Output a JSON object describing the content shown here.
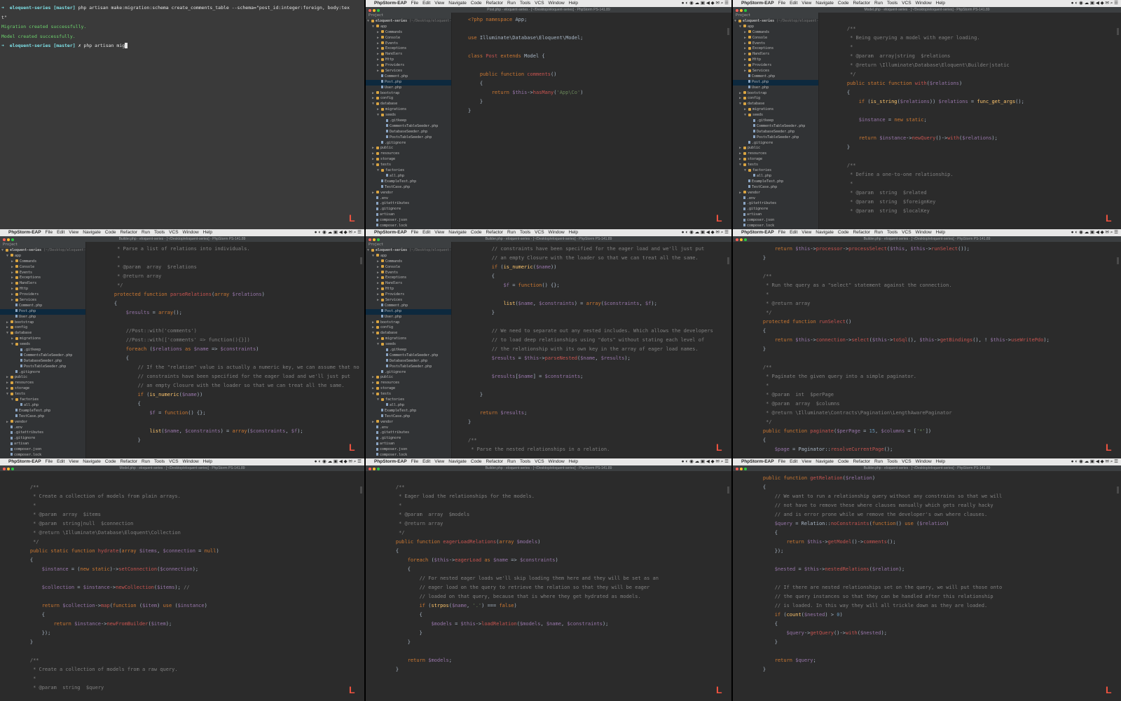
{
  "menubar": {
    "app": "PhpStorm-EAP",
    "items": [
      "File",
      "Edit",
      "View",
      "Navigate",
      "Code",
      "Refactor",
      "Run",
      "Tools",
      "VCS",
      "Window",
      "Help"
    ]
  },
  "terminal": {
    "lines": [
      {
        "prompt": "➜  eloquent-series [master]",
        "cmd": " php artisan make:migration:schema create_comments_table --schema=\"post_id:integer:foreign, body:tex"
      },
      {
        "prompt": "",
        "cmd": "t\""
      },
      {
        "prompt": "",
        "cmd": "Migration created successfully.",
        "cls": "green"
      },
      {
        "prompt": "",
        "cmd": "Model created successfully.",
        "cls": "green"
      },
      {
        "prompt": "➜  eloquent-series [master]",
        "cmd": " ✗ php artisan mig"
      }
    ]
  },
  "titles": {
    "post": "Post.php - eloquent-series - [~/Desktop/eloquent-series] - PhpStorm PS-141.89",
    "model": "Model.php - eloquent-series - [~/Desktop/eloquent-series] - PhpStorm PS-141.89",
    "builder": "Builder.php - eloquent-series - [~/Desktop/eloquent-series] - PhpStorm PS-141.89",
    "builder2": "Builder.php - eloquent-series - [~/Desktop/eloquent-series] - PhpStorm PS-141.89"
  },
  "tree": {
    "project_label": "Project",
    "root": "eloquent-series",
    "root_path": "~/Desktop/eloquent-series",
    "rows": [
      {
        "d": 1,
        "t": "app",
        "folder": true,
        "open": true
      },
      {
        "d": 2,
        "t": "Commands",
        "folder": true
      },
      {
        "d": 2,
        "t": "Console",
        "folder": true
      },
      {
        "d": 2,
        "t": "Events",
        "folder": true
      },
      {
        "d": 2,
        "t": "Exceptions",
        "folder": true
      },
      {
        "d": 2,
        "t": "Handlers",
        "folder": true
      },
      {
        "d": 2,
        "t": "Http",
        "folder": true
      },
      {
        "d": 2,
        "t": "Providers",
        "folder": true
      },
      {
        "d": 2,
        "t": "Services",
        "folder": true
      },
      {
        "d": 2,
        "t": "Comment.php"
      },
      {
        "d": 2,
        "t": "Post.php",
        "sel": true
      },
      {
        "d": 2,
        "t": "User.php"
      },
      {
        "d": 1,
        "t": "bootstrap",
        "folder": true
      },
      {
        "d": 1,
        "t": "config",
        "folder": true
      },
      {
        "d": 1,
        "t": "database",
        "folder": true,
        "open": true
      },
      {
        "d": 2,
        "t": "migrations",
        "folder": true
      },
      {
        "d": 2,
        "t": "seeds",
        "folder": true,
        "open": true
      },
      {
        "d": 3,
        "t": ".gitkeep"
      },
      {
        "d": 3,
        "t": "CommentsTableSeeder.php"
      },
      {
        "d": 3,
        "t": "DatabaseSeeder.php"
      },
      {
        "d": 3,
        "t": "PostsTableSeeder.php"
      },
      {
        "d": 2,
        "t": ".gitignore"
      },
      {
        "d": 1,
        "t": "public",
        "folder": true
      },
      {
        "d": 1,
        "t": "resources",
        "folder": true
      },
      {
        "d": 1,
        "t": "storage",
        "folder": true
      },
      {
        "d": 1,
        "t": "tests",
        "folder": true,
        "open": true
      },
      {
        "d": 2,
        "t": "factories",
        "folder": true,
        "open": true
      },
      {
        "d": 3,
        "t": "all.php"
      },
      {
        "d": 2,
        "t": "ExampleTest.php"
      },
      {
        "d": 2,
        "t": "TestCase.php"
      },
      {
        "d": 1,
        "t": "vendor",
        "folder": true
      },
      {
        "d": 1,
        "t": ".env"
      },
      {
        "d": 1,
        "t": ".gitattributes"
      },
      {
        "d": 1,
        "t": ".gitignore"
      },
      {
        "d": 1,
        "t": "artisan"
      },
      {
        "d": 1,
        "t": "composer.json"
      },
      {
        "d": 1,
        "t": "composer.lock"
      }
    ]
  },
  "panels": {
    "p2": [
      "<span class='k'>&lt;?php</span> <span class='k'>namespace</span> App;",
      "",
      "<span class='k'>use</span> Illuminate\\Database\\Eloquent\\Model;",
      "",
      "<span class='k'>class</span> <span class='m'>Post</span> <span class='k'>extends</span> Model {",
      "",
      "    <span class='k'>public function</span> <span class='m'>comments</span>()",
      "    {",
      "        <span class='k'>return</span> <span class='v'>$this</span>-&gt;<span class='m'>hasMany</span>(<span class='s'>'App\\Co'</span>)",
      "    }",
      "}"
    ],
    "p3": [
      "",
      "    <span class='c'>/**</span>",
      "    <span class='c'> * Being querying a model with eager loading.</span>",
      "    <span class='c'> *</span>",
      "    <span class='c'> * @param  array|string  $relations</span>",
      "    <span class='c'> * @return \\Illuminate\\Database\\Eloquent\\Builder|static</span>",
      "    <span class='c'> */</span>",
      "    <span class='k'>public static function</span> <span class='m'>with</span>(<span class='v'>$relations</span>)",
      "    {",
      "        <span class='k'>if</span> (<span class='f'>is_string</span>(<span class='v'>$relations</span>)) <span class='v'>$relations</span> = <span class='f'>func_get_args</span>();",
      "",
      "        <span class='v'>$instance</span> = <span class='k'>new static</span>;",
      "",
      "        <span class='k'>return</span> <span class='v'>$instance</span>-&gt;<span class='m'>newQuery</span>()-&gt;<span class='m'>with</span>(<span class='v'>$relations</span>);",
      "    }",
      "",
      "    <span class='c'>/**</span>",
      "    <span class='c'> * Define a one-to-one relationship.</span>",
      "    <span class='c'> *</span>",
      "    <span class='c'> * @param  string  $related</span>",
      "    <span class='c'> * @param  string  $foreignKey</span>",
      "    <span class='c'> * @param  string  $localKey</span>"
    ],
    "p4": [
      "    <span class='c'> * Parse a list of relations into individuals.</span>",
      "    <span class='c'> *</span>",
      "    <span class='c'> * @param  array  $relations</span>",
      "    <span class='c'> * @return array</span>",
      "    <span class='c'> */</span>",
      "    <span class='k'>protected function</span> <span class='m'>parseRelations</span>(<span class='k'>array</span> <span class='v'>$relations</span>)",
      "    {",
      "        <span class='v'>$results</span> = <span class='k'>array</span>();",
      "",
      "        <span class='c'>//Post::with('comments')</span>",
      "        <span class='c'>//Post::with(['comments' =&gt; function(){}])</span>",
      "        <span class='k'>foreach</span> (<span class='v'>$relations</span> <span class='k'>as</span> <span class='v'>$name</span> =&gt; <span class='v'>$constraints</span>)",
      "        {",
      "            <span class='c'>// If the \"relation\" value is actually a numeric key, we can assume that no</span>",
      "            <span class='c'>// constraints have been specified for the eager load and we'll just put</span>",
      "            <span class='c'>// an empty Closure with the loader so that we can treat all the same.</span>",
      "            <span class='k'>if</span> (<span class='f'>is_numeric</span>(<span class='v'>$name</span>))",
      "            {",
      "                <span class='v'>$f</span> = <span class='k'>function</span>() {};",
      "",
      "                <span class='f'>list</span>(<span class='v'>$name</span>, <span class='v'>$constraints</span>) = <span class='k'>array</span>(<span class='v'>$constraints</span>, <span class='v'>$f</span>);",
      "            }"
    ],
    "p5": [
      "        <span class='c'>// constraints have been specified for the eager load and we'll just put</span>",
      "        <span class='c'>// an empty Closure with the loader so that we can treat all the same.</span>",
      "        <span class='k'>if</span> (<span class='f'>is_numeric</span>(<span class='v'>$name</span>))",
      "        {",
      "            <span class='v'>$f</span> = <span class='k'>function</span>() {};",
      "",
      "            <span class='f'>list</span>(<span class='v'>$name</span>, <span class='v'>$constraints</span>) = <span class='k'>array</span>(<span class='v'>$constraints</span>, <span class='v'>$f</span>);",
      "        }",
      "",
      "        <span class='c'>// We need to separate out any nested includes. Which allows the developers</span>",
      "        <span class='c'>// to load deep relationships using \"dots\" without stating each level of</span>",
      "        <span class='c'>// the relationship with its own key in the array of eager load names.</span>",
      "        <span class='v'>$results</span> = <span class='v'>$this</span>-&gt;<span class='m'>parseNested</span>(<span class='v'>$name</span>, <span class='v'>$results</span>);",
      "",
      "        <span class='v'>$results</span>[<span class='v'>$name</span>] = <span class='v'>$constraints</span>;",
      "",
      "    }",
      "",
      "    <span class='k'>return</span> <span class='v'>$results</span>;",
      "}",
      "",
      "<span class='c'>/**</span>",
      "<span class='c'> * Parse the nested relationships in a relation.</span>"
    ],
    "p6": [
      "        <span class='k'>return</span> <span class='v'>$this</span>-&gt;<span class='m'>processor</span>-&gt;<span class='m'>processSelect</span>(<span class='v'>$this</span>, <span class='v'>$this</span>-&gt;<span class='m'>runSelect</span>());",
      "    }",
      "",
      "    <span class='c'>/**</span>",
      "    <span class='c'> * Run the query as a \"select\" statement against the connection.</span>",
      "    <span class='c'> *</span>",
      "    <span class='c'> * @return array</span>",
      "    <span class='c'> */</span>",
      "    <span class='k'>protected function</span> <span class='m'>runSelect</span>()",
      "    {",
      "        <span class='k'>return</span> <span class='v'>$this</span>-&gt;<span class='m'>connection</span>-&gt;<span class='m'>select</span>(<span class='v'>$this</span>-&gt;<span class='m'>toSql</span>(), <span class='v'>$this</span>-&gt;<span class='m'>getBindings</span>(), ! <span class='v'>$this</span>-&gt;<span class='m'>useWritePdo</span>);",
      "    }",
      "",
      "    <span class='c'>/**</span>",
      "    <span class='c'> * Paginate the given query into a simple paginator.</span>",
      "    <span class='c'> *</span>",
      "    <span class='c'> * @param  int  $perPage</span>",
      "    <span class='c'> * @param  array  $columns</span>",
      "    <span class='c'> * @return \\Illuminate\\Contracts\\Pagination\\LengthAwarePaginator</span>",
      "    <span class='c'> */</span>",
      "    <span class='k'>public function</span> <span class='m'>paginate</span>(<span class='v'>$perPage</span> = <span class='n'>15</span>, <span class='v'>$columns</span> = [<span class='s'>'*'</span>])",
      "    {",
      "        <span class='v'>$page</span> = Paginator::<span class='m'>resolveCurrentPage</span>();"
    ],
    "p7": [
      "",
      "    <span class='c'>/**</span>",
      "    <span class='c'> * Create a collection of models from plain arrays.</span>",
      "    <span class='c'> *</span>",
      "    <span class='c'> * @param  array  $items</span>",
      "    <span class='c'> * @param  string|null  $connection</span>",
      "    <span class='c'> * @return \\Illuminate\\Database\\Eloquent\\Collection</span>",
      "    <span class='c'> */</span>",
      "    <span class='k'>public static function</span> <span class='m'>hydrate</span>(<span class='k'>array</span> <span class='v'>$items</span>, <span class='v'>$connection</span> = <span class='k'>null</span>)",
      "    {",
      "        <span class='v'>$instance</span> = (<span class='k'>new static</span>)-&gt;<span class='m'>setConnection</span>(<span class='v'>$connection</span>);",
      "",
      "        <span class='v'>$collection</span> = <span class='v'>$instance</span>-&gt;<span class='m'>newCollection</span>(<span class='v'>$items</span>); <span class='c'>//</span>",
      "",
      "        <span class='k'>return</span> <span class='v'>$collection</span>-&gt;<span class='m'>map</span>(<span class='k'>function</span> (<span class='v'>$item</span>) <span class='k'>use</span> (<span class='v'>$instance</span>)",
      "        {",
      "            <span class='k'>return</span> <span class='v'>$instance</span>-&gt;<span class='m'>newFromBuilder</span>(<span class='v'>$item</span>);",
      "        });",
      "    }",
      "",
      "    <span class='c'>/**</span>",
      "    <span class='c'> * Create a collection of models from a raw query.</span>",
      "    <span class='c'> *</span>",
      "    <span class='c'> * @param  string  $query</span>"
    ],
    "p8": [
      "",
      "    <span class='c'>/**</span>",
      "    <span class='c'> * Eager load the relationships for the models.</span>",
      "    <span class='c'> *</span>",
      "    <span class='c'> * @param  array  $models</span>",
      "    <span class='c'> * @return array</span>",
      "    <span class='c'> */</span>",
      "    <span class='k'>public function</span> <span class='m'>eagerLoadRelations</span>(<span class='k'>array</span> <span class='v'>$models</span>)",
      "    {",
      "        <span class='k'>foreach</span> (<span class='v'>$this</span>-&gt;<span class='m'>eagerLoad</span> <span class='k'>as</span> <span class='v'>$name</span> =&gt; <span class='v'>$constraints</span>)",
      "        {",
      "            <span class='c'>// For nested eager loads we'll skip loading them here and they will be set as an</span>",
      "            <span class='c'>// eager load on the query to retrieve the relation so that they will be eager</span>",
      "            <span class='c'>// loaded on that query, because that is where they get hydrated as models.</span>",
      "            <span class='k'>if</span> (<span class='f'>strpos</span>(<span class='v'>$name</span>, <span class='s'>'.'</span>) === <span class='k'>false</span>)",
      "            {",
      "                <span class='v'>$models</span> = <span class='v'>$this</span>-&gt;<span class='m'>loadRelation</span>(<span class='v'>$models</span>, <span class='v'>$name</span>, <span class='v'>$constraints</span>);",
      "            }",
      "        }",
      "",
      "        <span class='k'>return</span> <span class='v'>$models</span>;",
      "    }"
    ],
    "p9": [
      "    <span class='k'>public function</span> <span class='m'>getRelation</span>(<span class='v'>$relation</span>)",
      "    {",
      "        <span class='c'>// We want to run a relationship query without any constrains so that we will</span>",
      "        <span class='c'>// not have to remove these where clauses manually which gets really hacky</span>",
      "        <span class='c'>// and is error prone while we remove the developer's own where clauses.</span>",
      "        <span class='v'>$query</span> = Relation::<span class='m'>noConstraints</span>(<span class='k'>function</span>() <span class='k'>use</span> (<span class='v'>$relation</span>)",
      "        {",
      "            <span class='k'>return</span> <span class='v'>$this</span>-&gt;<span class='m'>getModel</span>()-&gt;<span class='m'>comments</span>();",
      "        });",
      "",
      "        <span class='v'>$nested</span> = <span class='v'>$this</span>-&gt;<span class='m'>nestedRelations</span>(<span class='v'>$relation</span>);",
      "",
      "        <span class='c'>// If there are nested relationships set on the query, we will put those onto</span>",
      "        <span class='c'>// the query instances so that they can be handled after this relationship</span>",
      "        <span class='c'>// is loaded. In this way they will all trickle down as they are loaded.</span>",
      "        <span class='k'>if</span> (<span class='f'>count</span>(<span class='v'>$nested</span>) &gt; <span class='n'>0</span>)",
      "        {",
      "            <span class='v'>$query</span>-&gt;<span class='m'>getQuery</span>()-&gt;<span class='m'>with</span>(<span class='v'>$nested</span>);",
      "        }",
      "",
      "        <span class='k'>return</span> <span class='v'>$query</span>;",
      "    }"
    ]
  },
  "brand_letter": "L"
}
